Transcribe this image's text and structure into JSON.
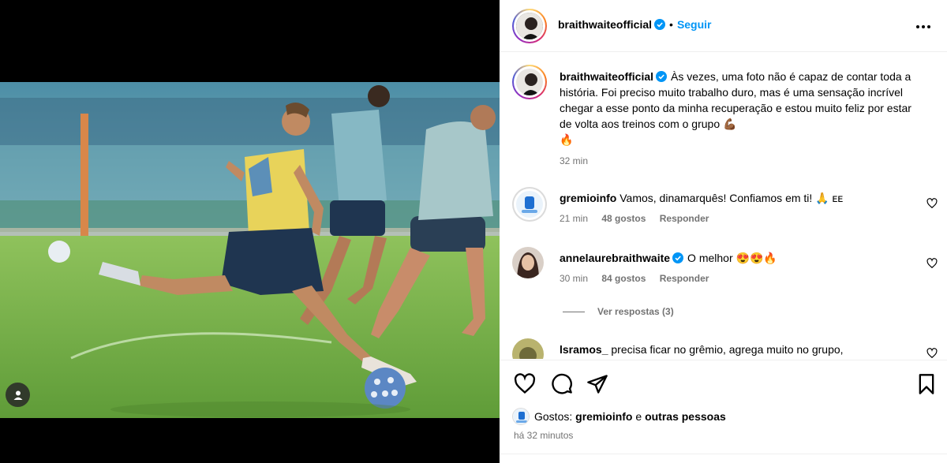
{
  "post": {
    "author": "braithwaiteofficial",
    "follow_label": "Seguir",
    "dot": "•",
    "caption": "Às vezes, uma foto não é capaz de contar toda a história. Foi preciso muito trabalho duro, mas é uma sensação incrível chegar a esse ponto da minha recuperação e estou muito feliz por estar de volta aos treinos com o grupo 💪🏾",
    "caption_emoji_2": "🔥",
    "caption_time": "32 min"
  },
  "comments": [
    {
      "user": "gremioinfo",
      "text": "Vamos, dinamarquês! Confiamos em ti! 🙏 ᴇᴇ",
      "time": "21 min",
      "likes": "48 gostos",
      "reply": "Responder"
    },
    {
      "user": "annelaurebraithwaite",
      "text": "O melhor 😍😍🔥",
      "time": "30 min",
      "likes": "84 gostos",
      "reply": "Responder"
    },
    {
      "user": "lsramos_",
      "text": "precisa ficar no grêmio, agrega muito no grupo,"
    }
  ],
  "view_replies": "Ver respostas (3)",
  "likes_line": {
    "prefix": "Gostos:",
    "user": "gremioinfo",
    "conj": "e",
    "others": "outras pessoas"
  },
  "posted_time": "há 32 minutos",
  "colors": {
    "link": "#0095f6",
    "verified": "#0095f6",
    "secondary": "#737373"
  },
  "icons": [
    "user-tag-icon",
    "verified-icon",
    "more-options-icon",
    "heart-icon",
    "comment-icon",
    "share-icon",
    "save-icon"
  ]
}
